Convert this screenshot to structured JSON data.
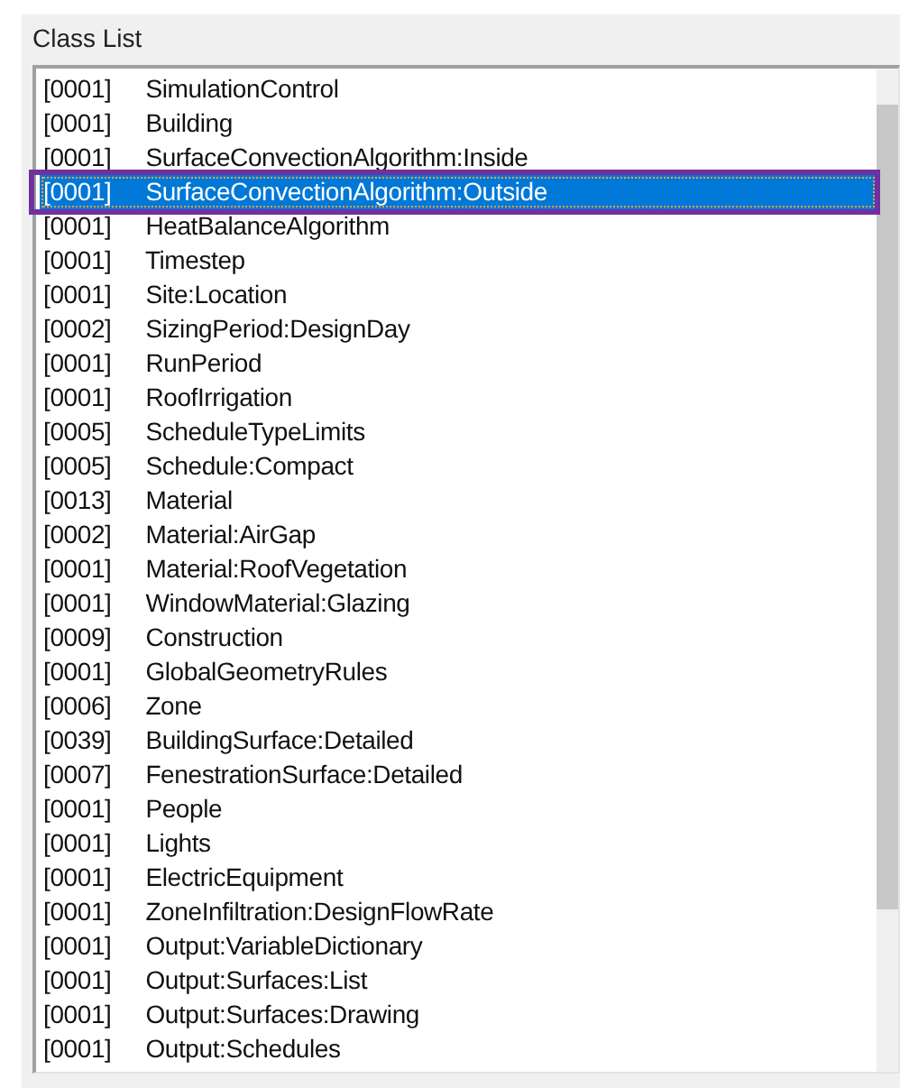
{
  "label": "Class List",
  "items": [
    {
      "count": "[0001]",
      "name": "SimulationControl",
      "selected": false
    },
    {
      "count": "[0001]",
      "name": "Building",
      "selected": false
    },
    {
      "count": "[0001]",
      "name": "SurfaceConvectionAlgorithm:Inside",
      "selected": false
    },
    {
      "count": "[0001]",
      "name": "SurfaceConvectionAlgorithm:Outside",
      "selected": true
    },
    {
      "count": "[0001]",
      "name": "HeatBalanceAlgorithm",
      "selected": false
    },
    {
      "count": "[0001]",
      "name": "Timestep",
      "selected": false
    },
    {
      "count": "[0001]",
      "name": "Site:Location",
      "selected": false
    },
    {
      "count": "[0002]",
      "name": "SizingPeriod:DesignDay",
      "selected": false
    },
    {
      "count": "[0001]",
      "name": "RunPeriod",
      "selected": false
    },
    {
      "count": "[0001]",
      "name": "RoofIrrigation",
      "selected": false
    },
    {
      "count": "[0005]",
      "name": "ScheduleTypeLimits",
      "selected": false
    },
    {
      "count": "[0005]",
      "name": "Schedule:Compact",
      "selected": false
    },
    {
      "count": "[0013]",
      "name": "Material",
      "selected": false
    },
    {
      "count": "[0002]",
      "name": "Material:AirGap",
      "selected": false
    },
    {
      "count": "[0001]",
      "name": "Material:RoofVegetation",
      "selected": false
    },
    {
      "count": "[0001]",
      "name": "WindowMaterial:Glazing",
      "selected": false
    },
    {
      "count": "[0009]",
      "name": "Construction",
      "selected": false
    },
    {
      "count": "[0001]",
      "name": "GlobalGeometryRules",
      "selected": false
    },
    {
      "count": "[0006]",
      "name": "Zone",
      "selected": false
    },
    {
      "count": "[0039]",
      "name": "BuildingSurface:Detailed",
      "selected": false
    },
    {
      "count": "[0007]",
      "name": "FenestrationSurface:Detailed",
      "selected": false
    },
    {
      "count": "[0001]",
      "name": "People",
      "selected": false
    },
    {
      "count": "[0001]",
      "name": "Lights",
      "selected": false
    },
    {
      "count": "[0001]",
      "name": "ElectricEquipment",
      "selected": false
    },
    {
      "count": "[0001]",
      "name": "ZoneInfiltration:DesignFlowRate",
      "selected": false
    },
    {
      "count": "[0001]",
      "name": "Output:VariableDictionary",
      "selected": false
    },
    {
      "count": "[0001]",
      "name": "Output:Surfaces:List",
      "selected": false
    },
    {
      "count": "[0001]",
      "name": "Output:Surfaces:Drawing",
      "selected": false
    },
    {
      "count": "[0001]",
      "name": "Output:Schedules",
      "selected": false
    }
  ]
}
